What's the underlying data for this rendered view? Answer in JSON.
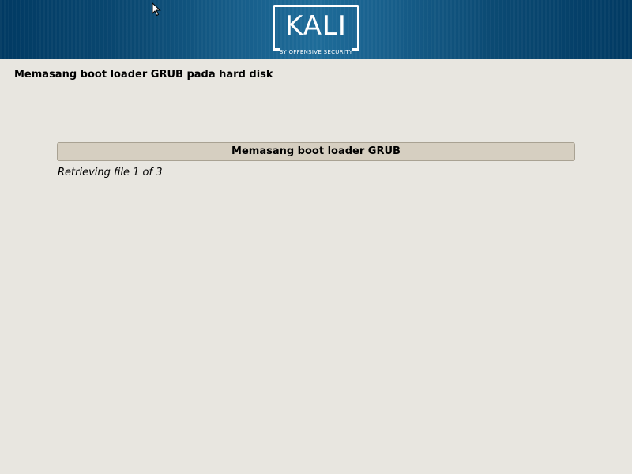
{
  "banner": {
    "logo_text": "KALI",
    "logo_subtext": "BY OFFENSIVE SECURITY"
  },
  "page": {
    "title": "Memasang boot loader GRUB pada hard disk"
  },
  "progress": {
    "label": "Memasang boot loader GRUB",
    "fraction": 0.0,
    "status": "Retrieving file 1 of 3"
  },
  "icons": {
    "cursor": "mouse-pointer-icon"
  },
  "colors": {
    "banner_dark": "#013a63",
    "banner_light": "#1e6c99",
    "background": "#e8e6e0",
    "progress_bar": "#d6cfc1"
  }
}
